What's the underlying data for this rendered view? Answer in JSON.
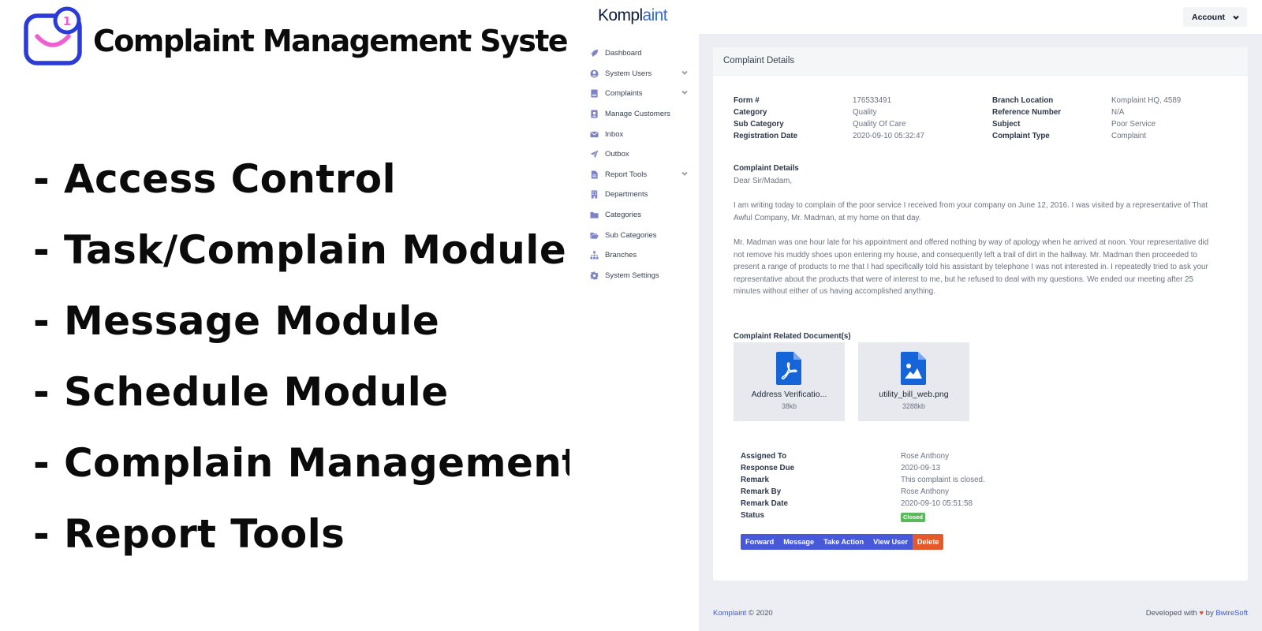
{
  "promo": {
    "title": "Complaint Management System",
    "logo_badge": "1",
    "features": [
      "- Access Control",
      "- Task/Complain Module",
      "- Message Module",
      "- Schedule Module",
      "- Complain Management",
      "- Report Tools"
    ],
    "colors": {
      "logo_outline": "#2a3bd6",
      "logo_accent": "#ef5fd1",
      "text": "#0b0b0b"
    }
  },
  "app": {
    "brand": {
      "part1": "Kompl",
      "part2": "aint"
    },
    "account_label": "Account",
    "sidebar": [
      {
        "label": "Dashboard",
        "icon": "rocket-icon",
        "expandable": false
      },
      {
        "label": "System Users",
        "icon": "user-circle-icon",
        "expandable": true
      },
      {
        "label": "Complaints",
        "icon": "inbox-tray-icon",
        "expandable": true
      },
      {
        "label": "Manage Customers",
        "icon": "contact-card-icon",
        "expandable": false
      },
      {
        "label": "Inbox",
        "icon": "envelope-icon",
        "expandable": false
      },
      {
        "label": "Outbox",
        "icon": "paper-plane-icon",
        "expandable": false
      },
      {
        "label": "Report Tools",
        "icon": "document-icon",
        "expandable": true
      },
      {
        "label": "Departments",
        "icon": "building-icon",
        "expandable": false
      },
      {
        "label": "Categories",
        "icon": "folder-icon",
        "expandable": false
      },
      {
        "label": "Sub Categories",
        "icon": "folder-open-icon",
        "expandable": false
      },
      {
        "label": "Branches",
        "icon": "sitemap-icon",
        "expandable": false
      },
      {
        "label": "System Settings",
        "icon": "gear-icon",
        "expandable": false
      }
    ],
    "card_title": "Complaint Details",
    "info_left": [
      {
        "label": "Form #",
        "value": "176533491"
      },
      {
        "label": "Category",
        "value": "Quality"
      },
      {
        "label": "Sub Category",
        "value": "Quality Of Care"
      },
      {
        "label": "Registration Date",
        "value": "2020-09-10 05:32:47"
      }
    ],
    "info_right": [
      {
        "label": "Branch Location",
        "value": "Komplaint HQ, 4589"
      },
      {
        "label": "Reference Number",
        "value": "N/A"
      },
      {
        "label": "Subject",
        "value": "Poor Service"
      },
      {
        "label": "Complaint Type",
        "value": "Complaint"
      }
    ],
    "details_heading": "Complaint Details",
    "letter": {
      "salutation": "Dear Sir/Madam,",
      "paragraph1": "I am writing today to complain of the poor service I received from your company on June 12, 2016. I was visited by a representative of That Awful Company, Mr. Madman, at my home on that day.",
      "paragraph2": "Mr. Madman was one hour late for his appointment and offered nothing by way of apology when he arrived at noon. Your representative did not remove his muddy shoes upon entering my house, and consequently left a trail of dirt in the hallway. Mr. Madman then proceeded to present a range of products to me that I had specifically told his assistant by telephone I was not interested in. I repeatedly tried to ask your representative about the products that were of interest to me, but he refused to deal with my questions. We ended our meeting after 25 minutes without either of us having accomplished anything."
    },
    "documents_heading": "Complaint Related Document(s)",
    "documents": [
      {
        "name": "Address Verificatio...",
        "size": "38kb",
        "icon": "pdf-file-icon"
      },
      {
        "name": "utility_bill_web.png",
        "size": "3288kb",
        "icon": "image-file-icon"
      }
    ],
    "assignment": [
      {
        "label": "Assigned To",
        "value": "Rose Anthony"
      },
      {
        "label": "Response Due",
        "value": "2020-09-13"
      },
      {
        "label": "Remark",
        "value": "This complaint is closed."
      },
      {
        "label": "Remark By",
        "value": "Rose Anthony"
      },
      {
        "label": "Remark Date",
        "value": "2020-09-10 05:51:58"
      },
      {
        "label": "Status",
        "value": ""
      }
    ],
    "status_badge": "Closed",
    "actions": {
      "forward": "Forward",
      "message": "Message",
      "take_action": "Take Action",
      "view_user": "View User",
      "delete": "Delete"
    },
    "footer": {
      "brand": "Komplaint",
      "copyright": " © 2020",
      "developed_with": "Developed with ",
      "heart": "♥",
      "by": " by ",
      "company": "BwireSoft"
    },
    "colors": {
      "primary": "#4759d8",
      "danger": "#e55a2b",
      "success": "#5cb85c",
      "brand_accent": "#2f6be0",
      "main_bg": "#eceef4"
    }
  }
}
